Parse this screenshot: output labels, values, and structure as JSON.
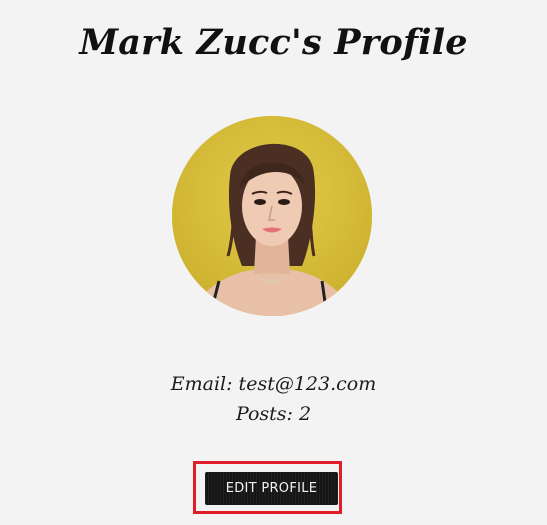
{
  "profile": {
    "title": "Mark Zucc's Profile",
    "email_line": "Email: test@123.com",
    "posts_line": "Posts: 2"
  },
  "actions": {
    "edit_label": "EDIT PROFILE"
  },
  "colors": {
    "background": "#f4f3f3",
    "avatar_backdrop": "#d7c03a",
    "button": "#151515",
    "highlight": "#e01e2a"
  }
}
